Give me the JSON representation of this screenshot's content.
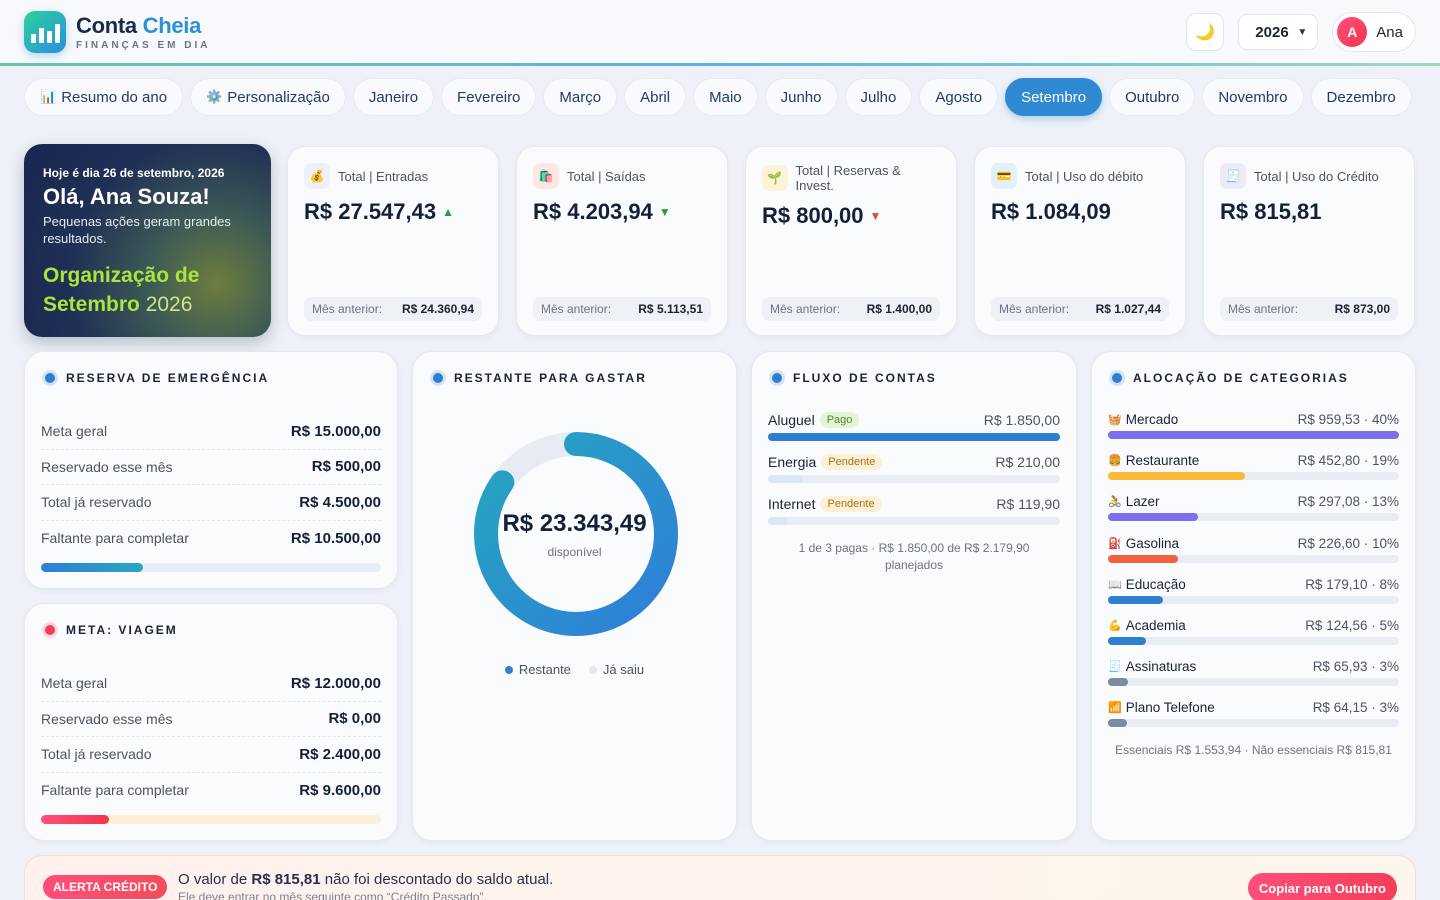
{
  "header": {
    "brand_part1": "Conta ",
    "brand_part2": "Cheia",
    "brand_sub": "FINANÇAS EM DIA",
    "theme_icon": "moon-icon",
    "year": "2026",
    "user_initial": "A",
    "user_name": "Ana"
  },
  "tabs": [
    {
      "label": "Resumo do ano",
      "icon": "📊"
    },
    {
      "label": "Personalização",
      "icon": "⚙️"
    },
    {
      "label": "Janeiro"
    },
    {
      "label": "Fevereiro"
    },
    {
      "label": "Março"
    },
    {
      "label": "Abril"
    },
    {
      "label": "Maio"
    },
    {
      "label": "Junho"
    },
    {
      "label": "Julho"
    },
    {
      "label": "Agosto"
    },
    {
      "label": "Setembro",
      "active": true
    },
    {
      "label": "Outubro"
    },
    {
      "label": "Novembro"
    },
    {
      "label": "Dezembro"
    }
  ],
  "hero": {
    "date": "Hoje é dia 26 de setembro, 2026",
    "hello": "Olá, Ana Souza!",
    "tagline": "Pequenas ações geram grandes resultados.",
    "org_line1": "Organização de",
    "org_line2": "Setembro",
    "org_year": "2026"
  },
  "summary": [
    {
      "title": "Total | Entradas",
      "icon": "💰",
      "value": "R$ 27.547,43",
      "trend": "▲",
      "trend_color": "#2e9b3a",
      "prev_label": "Mês anterior:",
      "prev_value": "R$ 24.360,94",
      "icon_bg": "#eef2f8"
    },
    {
      "title": "Total | Saídas",
      "icon": "🛍️",
      "value": "R$ 4.203,94",
      "trend": "▼",
      "trend_color": "#2e9b3a",
      "prev_label": "Mês anterior:",
      "prev_value": "R$ 5.113,51",
      "icon_bg": "#fde8e4"
    },
    {
      "title": "Total | Reservas & Invest.",
      "icon": "🌱",
      "value": "R$ 800,00",
      "trend": "▼",
      "trend_color": "#e24b3b",
      "prev_label": "Mês anterior:",
      "prev_value": "R$ 1.400,00",
      "icon_bg": "#fdf3d9"
    },
    {
      "title": "Total | Uso do débito",
      "icon": "💳",
      "value": "R$ 1.084,09",
      "trend": "",
      "trend_color": "#2e9b3a",
      "prev_label": "Mês anterior:",
      "prev_value": "R$ 1.027,44",
      "icon_bg": "#e3f0fb"
    },
    {
      "title": "Total | Uso do Crédito",
      "icon": "🧾",
      "value": "R$ 815,81",
      "trend": "",
      "trend_color": "#2e9b3a",
      "prev_label": "Mês anterior:",
      "prev_value": "R$ 873,00",
      "icon_bg": "#ecebf6"
    }
  ],
  "emergencia": {
    "title": "RESERVA DE EMERGÊNCIA",
    "rows": [
      {
        "label": "Meta geral",
        "value": "R$ 15.000,00"
      },
      {
        "label": "Reservado esse mês",
        "value": "R$ 500,00"
      },
      {
        "label": "Total já reservado",
        "value": "R$ 4.500,00"
      },
      {
        "label": "Faltante para completar",
        "value": "R$ 10.500,00"
      }
    ],
    "progress": 0.3,
    "bar_color": "#2e7fd2",
    "track_color": "#e6edf6"
  },
  "viagem": {
    "title": "META: VIAGEM",
    "rows": [
      {
        "label": "Meta geral",
        "value": "R$ 12.000,00"
      },
      {
        "label": "Reservado esse mês",
        "value": "R$ 0,00"
      },
      {
        "label": "Total já reservado",
        "value": "R$ 2.400,00"
      },
      {
        "label": "Faltante para completar",
        "value": "R$ 9.600,00"
      }
    ],
    "progress": 0.2,
    "bar_color": "#f5445f",
    "track_color": "#fdf0d6"
  },
  "restante": {
    "title": "RESTANTE PARA GASTAR",
    "value": "R$ 23.343,49",
    "caption": "disponível",
    "fraction_remaining": 0.847,
    "legend_remaining": "Restante",
    "legend_spent": "Já saiu",
    "remaining_color": "#2e8fd4",
    "spent_color": "#e6ebf4"
  },
  "fluxo": {
    "title": "FLUXO DE CONTAS",
    "items": [
      {
        "name": "Aluguel",
        "status": "Pago",
        "status_type": "pago",
        "value": "R$ 1.850,00",
        "progress": 1.0
      },
      {
        "name": "Energia",
        "status": "Pendente",
        "status_type": "pend",
        "value": "R$ 210,00",
        "progress": 0.12
      },
      {
        "name": "Internet",
        "status": "Pendente",
        "status_type": "pend",
        "value": "R$ 119,90",
        "progress": 0.07
      }
    ],
    "note": "1 de 3 pagas · R$ 1.850,00 de R$ 2.179,90 planejados"
  },
  "alocacao": {
    "title": "ALOCAÇÃO DE CATEGORIAS",
    "items": [
      {
        "name": "Mercado",
        "icon": "🧺",
        "value": "R$ 959,53 · 40%",
        "progress": 1.0,
        "color": "#7c6ff0"
      },
      {
        "name": "Restaurante",
        "icon": "🍔",
        "value": "R$ 452,80 · 19%",
        "progress": 0.47,
        "color": "#fbb938"
      },
      {
        "name": "Lazer",
        "icon": "🚴",
        "value": "R$ 297,08 · 13%",
        "progress": 0.31,
        "color": "#7c6ff0"
      },
      {
        "name": "Gasolina",
        "icon": "⛽",
        "value": "R$ 226,60 · 10%",
        "progress": 0.24,
        "color": "#f2613d"
      },
      {
        "name": "Educação",
        "icon": "📖",
        "value": "R$ 179,10 · 8%",
        "progress": 0.19,
        "color": "#2e7fd2"
      },
      {
        "name": "Academia",
        "icon": "💪",
        "value": "R$ 124,56 · 5%",
        "progress": 0.13,
        "color": "#2e7fd2"
      },
      {
        "name": "Assinaturas",
        "icon": "🧾",
        "value": "R$ 65,93 · 3%",
        "progress": 0.07,
        "color": "#7b8ba0"
      },
      {
        "name": "Plano Telefone",
        "icon": "📶",
        "value": "R$ 64,15 · 3%",
        "progress": 0.065,
        "color": "#7b8ba0"
      }
    ],
    "note": "Essenciais R$ 1.553,94 · Não essenciais R$ 815,81"
  },
  "alert": {
    "badge": "ALERTA CRÉDITO",
    "text_pre": "O valor de ",
    "text_amount": "R$ 815,81",
    "text_post": " não foi descontado do saldo atual.",
    "sub": "Ele deve entrar no mês seguinte como “Crédito Passado”.",
    "button": "Copiar para Outubro"
  }
}
